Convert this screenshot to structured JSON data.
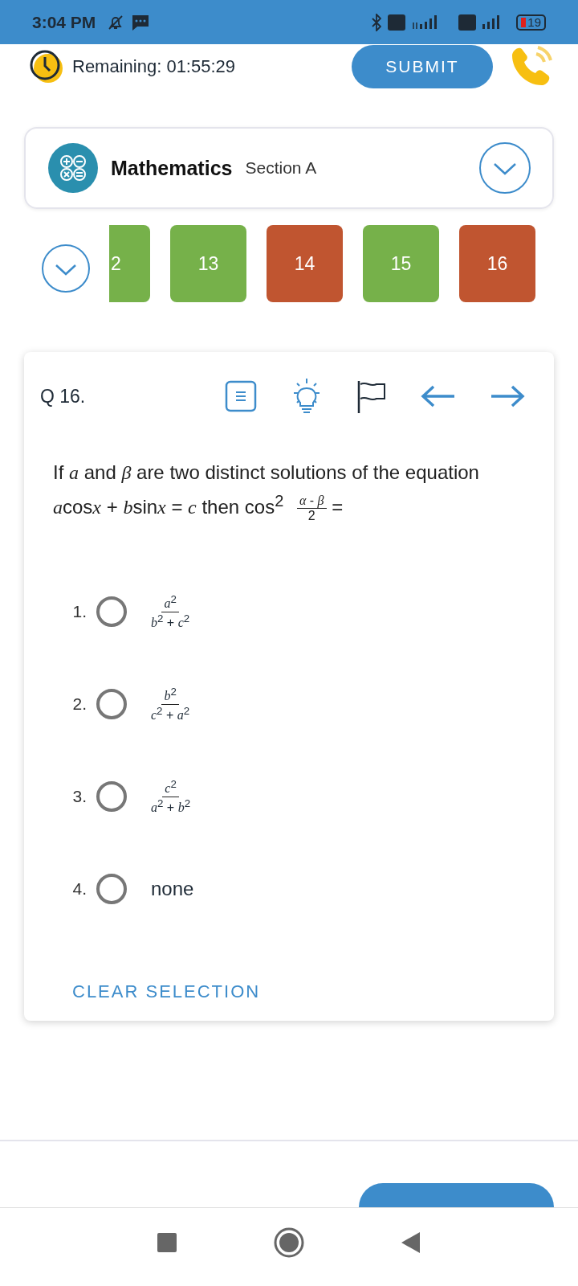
{
  "status_bar": {
    "time": "3:04 PM",
    "battery": "19"
  },
  "header": {
    "timer": "Remaining: 01:55:29",
    "submit": "SUBMIT"
  },
  "subject": {
    "name": "Mathematics",
    "section": "Section A"
  },
  "palette": [
    {
      "label": "2",
      "color": "#76b14a",
      "kind": "partial"
    },
    {
      "label": "13",
      "color": "#76b14a",
      "kind": "tile"
    },
    {
      "label": "14",
      "color": "#c05530",
      "kind": "tile"
    },
    {
      "label": "15",
      "color": "#76b14a",
      "kind": "tile"
    },
    {
      "label": "16",
      "color": "#c05530",
      "kind": "tile"
    }
  ],
  "question": {
    "number": "Q 16.",
    "segments": [
      {
        "kind": "plain",
        "text": "If "
      },
      {
        "kind": "var",
        "text": "a"
      },
      {
        "kind": "plain",
        "text": " and "
      },
      {
        "kind": "var",
        "text": "β"
      },
      {
        "kind": "plain",
        "text": " are two distinct solutions of the equation "
      },
      {
        "kind": "var",
        "text": "a"
      },
      {
        "kind": "plain",
        "text": "cos"
      },
      {
        "kind": "var",
        "text": "x"
      },
      {
        "kind": "plain",
        "text": " + "
      },
      {
        "kind": "var",
        "text": "b"
      },
      {
        "kind": "plain",
        "text": "sin"
      },
      {
        "kind": "var",
        "text": "x"
      },
      {
        "kind": "plain",
        "text": " = "
      },
      {
        "kind": "var",
        "text": "c"
      },
      {
        "kind": "plain",
        "text": " then cos"
      },
      {
        "kind": "sup",
        "text": "2"
      }
    ],
    "fraction": {
      "numerator": "*α* - *β*",
      "denominator": "2"
    },
    "suffix": "="
  },
  "options": [
    {
      "number": "1.",
      "kind": "fraction",
      "numerator": "*a*$^{2}$",
      "denominator": "*b*$^{2}$ + *c*$^{2}$",
      "selected": false
    },
    {
      "number": "2.",
      "kind": "fraction",
      "numerator": "*b*$^{2}$",
      "denominator": "*c*$^{2}$ + *a*$^{2}$",
      "selected": false
    },
    {
      "number": "3.",
      "kind": "fraction",
      "numerator": "*c*$^{2}$",
      "denominator": "*a*$^{2}$ + *b*$^{2}$",
      "selected": false
    },
    {
      "number": "4.",
      "kind": "text",
      "text": "none",
      "selected": false
    }
  ],
  "clear_selection": "CLEAR SELECTION"
}
